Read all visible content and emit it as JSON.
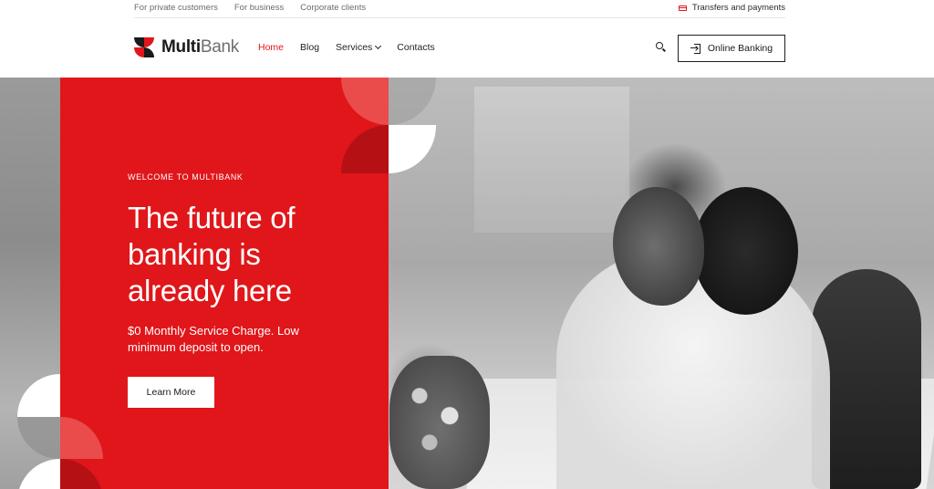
{
  "topbar": {
    "links": [
      "For private customers",
      "For business",
      "Corporate clients"
    ],
    "transfers_label": "Transfers and payments"
  },
  "header": {
    "logo": {
      "part1": "Multi",
      "part2": "Bank"
    },
    "nav": [
      {
        "label": "Home",
        "active": true
      },
      {
        "label": "Blog",
        "active": false
      },
      {
        "label": "Services",
        "active": false,
        "has_dropdown": true
      },
      {
        "label": "Contacts",
        "active": false
      }
    ],
    "search_icon": "search-icon",
    "online_banking_label": "Online Banking"
  },
  "hero": {
    "eyebrow": "WELCOME TO MULTIBANK",
    "title": "The future of banking is already here",
    "subtitle": "$0 Monthly Service Charge. Low minimum deposit to open.",
    "cta_label": "Learn More"
  },
  "colors": {
    "accent_red": "#e0161a",
    "dark_red": "#b51014",
    "light_red": "#ea4b4b"
  }
}
